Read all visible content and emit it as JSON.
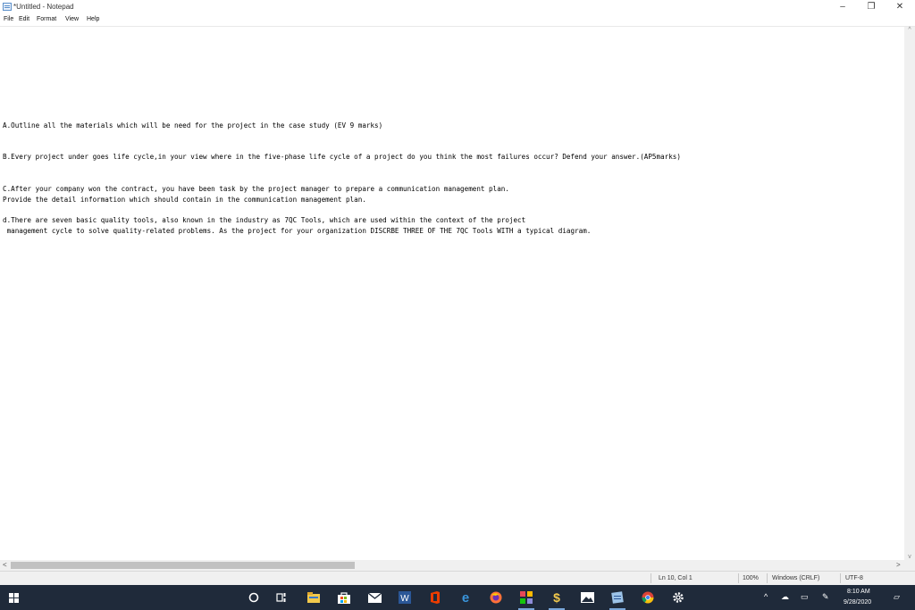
{
  "window": {
    "title": "*Untitled - Notepad",
    "minimize": "–",
    "maximize": "❐",
    "close": "✕"
  },
  "menu": [
    "File",
    "Edit",
    "Format",
    "View",
    "Help"
  ],
  "document": {
    "lines": [
      "A.Outline all the materials which will be need for the project in the case study (EV 9 marks)",
      "B.Every project under goes life cycle,in your view where in the five-phase life cycle of a project do you think the most failures occur? Defend your answer.(AP5marks)",
      "C.After your company won the contract, you have been task by the project manager to prepare a communication management plan.",
      "Provide the detail information which should contain in the communication management plan.",
      "d.There are seven basic quality tools, also known in the industry as 7QC Tools, which are used within the context of the project",
      " management cycle to solve quality-related problems. As the project for your organization DISCRBE THREE OF THE 7QC Tools WITH a typical diagram."
    ]
  },
  "scrollbars": {
    "horizontal_position_fraction": 0.0,
    "left_arrow": "<",
    "right_arrow": ">",
    "up_arrow": "^",
    "down_arrow": "v"
  },
  "status": {
    "position": "Ln 10, Col 1",
    "zoom": "100%",
    "line_ending": "Windows (CRLF)",
    "encoding": "UTF-8"
  },
  "taskbar": {
    "icons": [
      "start-icon",
      "search-circle-icon",
      "task-view-icon",
      "file-explorer-icon",
      "store-icon",
      "mail-icon",
      "word-icon",
      "office-icon",
      "edge-icon",
      "firefox-icon",
      "calculator-app-icon",
      "dollar-app-icon",
      "photos-icon",
      "notepad-icon",
      "chrome-icon",
      "settings-icon"
    ],
    "time": "8:10 AM",
    "date": "9/28/2020"
  },
  "colors": {
    "taskbar_bg": "#1f2a3a",
    "status_bg": "#f0f0f0",
    "accent": "#7aa7d9"
  }
}
